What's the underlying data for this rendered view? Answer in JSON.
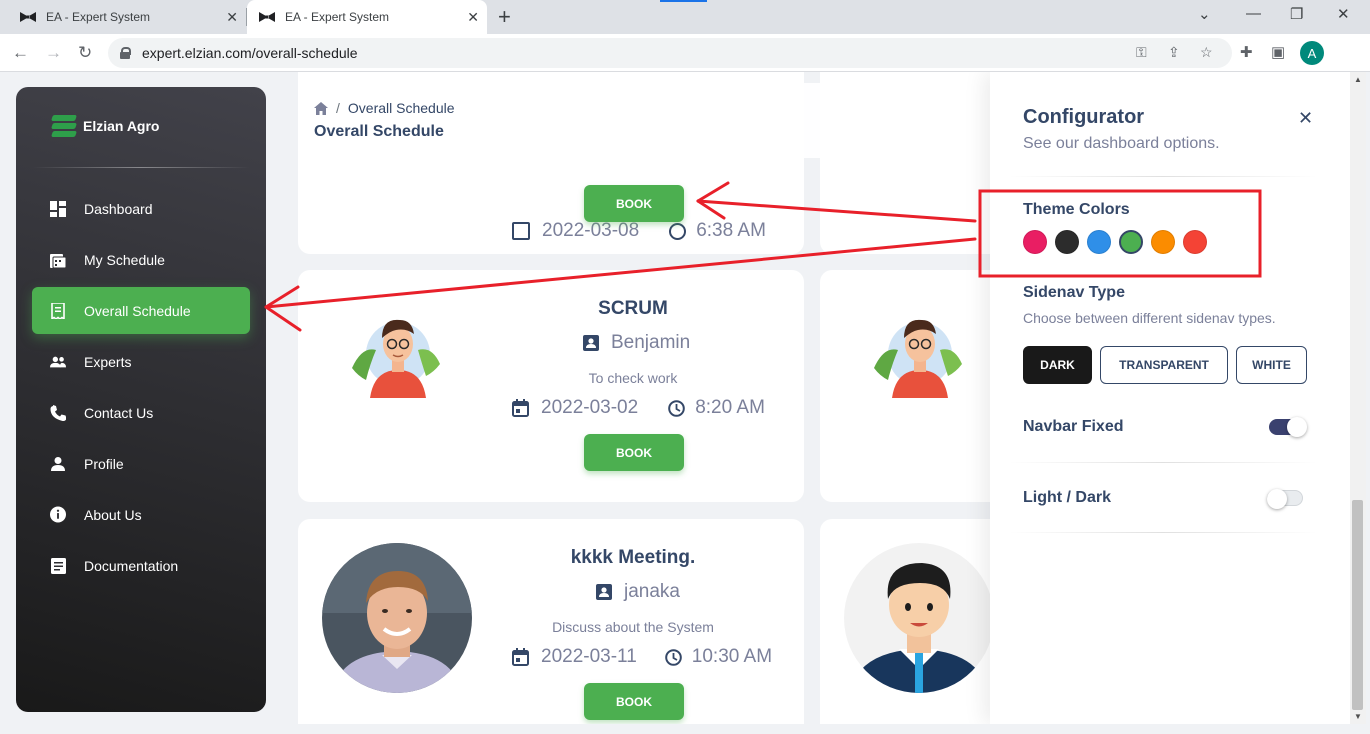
{
  "browser": {
    "tabs": [
      {
        "title": "EA - Expert System",
        "active": false
      },
      {
        "title": "EA - Expert System",
        "active": true
      }
    ],
    "url": "expert.elzian.com/overall-schedule",
    "profile_initial": "A"
  },
  "sidebar": {
    "brand": "Elzian Agro",
    "items": [
      {
        "label": "Dashboard",
        "icon": "dashboard-icon",
        "active": false
      },
      {
        "label": "My Schedule",
        "icon": "schedule-icon",
        "active": false
      },
      {
        "label": "Overall Schedule",
        "icon": "receipt-icon",
        "active": true
      },
      {
        "label": "Experts",
        "icon": "people-icon",
        "active": false
      },
      {
        "label": "Contact Us",
        "icon": "phone-icon",
        "active": false
      },
      {
        "label": "Profile",
        "icon": "person-icon",
        "active": false
      },
      {
        "label": "About Us",
        "icon": "info-icon",
        "active": false
      },
      {
        "label": "Documentation",
        "icon": "document-icon",
        "active": false
      }
    ]
  },
  "header": {
    "breadcrumb": "Overall Schedule",
    "title": "Overall Schedule"
  },
  "cards": [
    {
      "date": "2022-03-08",
      "time": "6:38 AM",
      "button": "BOOK"
    },
    {
      "title": "SCRUM",
      "expert": "Benjamin",
      "description": "To check work",
      "date": "2022-03-02",
      "time": "8:20 AM",
      "button": "BOOK"
    },
    {
      "title": "kkkk Meeting.",
      "expert": "janaka",
      "description": "Discuss about the System",
      "date": "2022-03-11",
      "time": "10:30 AM",
      "button": "BOOK"
    }
  ],
  "configurator": {
    "title": "Configurator",
    "subtitle": "See our dashboard options.",
    "theme_colors_label": "Theme Colors",
    "theme_colors": [
      "#e91e63",
      "#2c2c2c",
      "#2f8fe8",
      "#4caf50",
      "#fb8c00",
      "#f44335"
    ],
    "selected_color": "#4caf50",
    "sidenav_label": "Sidenav Type",
    "sidenav_hint": "Choose between different sidenav types.",
    "sidenav_options": [
      "DARK",
      "TRANSPARENT",
      "WHITE"
    ],
    "sidenav_selected": "DARK",
    "navbar_fixed_label": "Navbar Fixed",
    "navbar_fixed": true,
    "light_dark_label": "Light / Dark",
    "dark_mode": false
  },
  "colors": {
    "accent": "#4caf50",
    "annotation": "#e8202a"
  }
}
